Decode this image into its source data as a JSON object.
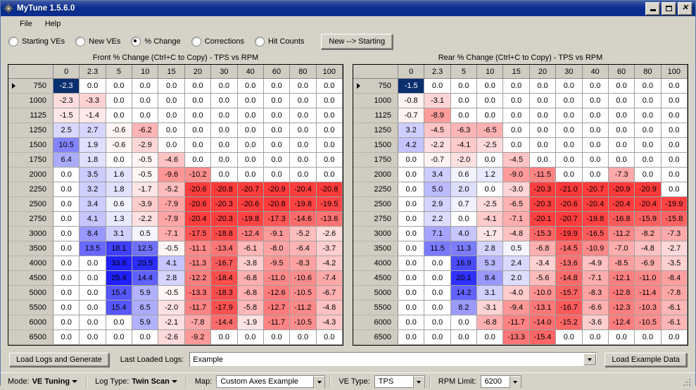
{
  "window": {
    "title": "MyTune 1.5.6.0",
    "icon": "app-gear-icon",
    "minimize": "–",
    "maximize": "□",
    "close": "✕"
  },
  "menu": {
    "items": [
      "File",
      "Help"
    ]
  },
  "view_modes": {
    "options": [
      "Starting VEs",
      "New VEs",
      "% Change",
      "Corrections",
      "Hit Counts"
    ],
    "selected": "% Change",
    "action_button": "New --> Starting"
  },
  "tables": [
    {
      "caption": "Front % Change (Ctrl+C to Copy) - TPS vs RPM",
      "corner": "",
      "columns": [
        "0",
        "2.3",
        "5",
        "10",
        "15",
        "20",
        "30",
        "40",
        "60",
        "80",
        "100"
      ],
      "rows": [
        "750",
        "1000",
        "1125",
        "1250",
        "1500",
        "1750",
        "2000",
        "2250",
        "2500",
        "2750",
        "3000",
        "3500",
        "4000",
        "4500",
        "5000",
        "5500",
        "6000",
        "6500"
      ],
      "selected_cell": [
        0,
        0
      ],
      "values": [
        [
          "-2.3",
          "0.0",
          "0.0",
          "0.0",
          "0.0",
          "0.0",
          "0.0",
          "0.0",
          "0.0",
          "0.0",
          "0.0"
        ],
        [
          "-2.3",
          "-3.3",
          "0.0",
          "0.0",
          "0.0",
          "0.0",
          "0.0",
          "0.0",
          "0.0",
          "0.0",
          "0.0"
        ],
        [
          "-1.5",
          "-1.4",
          "0.0",
          "0.0",
          "0.0",
          "0.0",
          "0.0",
          "0.0",
          "0.0",
          "0.0",
          "0.0"
        ],
        [
          "2.5",
          "2.7",
          "-0.6",
          "-6.2",
          "0.0",
          "0.0",
          "0.0",
          "0.0",
          "0.0",
          "0.0",
          "0.0"
        ],
        [
          "10.5",
          "1.9",
          "-0.6",
          "-2.9",
          "0.0",
          "0.0",
          "0.0",
          "0.0",
          "0.0",
          "0.0",
          "0.0"
        ],
        [
          "6.4",
          "1.8",
          "0.0",
          "-0.5",
          "-4.6",
          "0.0",
          "0.0",
          "0.0",
          "0.0",
          "0.0",
          "0.0"
        ],
        [
          "0.0",
          "3.5",
          "1.6",
          "-0.5",
          "-9.6",
          "-10.2",
          "0.0",
          "0.0",
          "0.0",
          "0.0",
          "0.0"
        ],
        [
          "0.0",
          "3.2",
          "1.8",
          "-1.7",
          "-5.2",
          "-20.6",
          "-20.8",
          "-20.7",
          "-20.9",
          "-20.4",
          "-20.8"
        ],
        [
          "0.0",
          "3.4",
          "0.6",
          "-3.9",
          "-7.9",
          "-20.6",
          "-20.3",
          "-20.6",
          "-20.8",
          "-19.8",
          "-19.5"
        ],
        [
          "0.0",
          "4.1",
          "1.3",
          "-2.2",
          "-7.9",
          "-20.4",
          "-20.3",
          "-19.8",
          "-17.3",
          "-14.6",
          "-13.6"
        ],
        [
          "0.0",
          "8.4",
          "3.1",
          "0.5",
          "-7.1",
          "-17.5",
          "-18.8",
          "-12.4",
          "-9.1",
          "-5.2",
          "-2.6"
        ],
        [
          "0.0",
          "13.5",
          "18.1",
          "12.5",
          "-0.5",
          "-11.1",
          "-13.4",
          "-6.1",
          "-8.0",
          "-6.4",
          "-3.7"
        ],
        [
          "0.0",
          "0.0",
          "33.8",
          "20.5",
          "4.1",
          "-11.3",
          "-16.7",
          "-3.8",
          "-9.5",
          "-8.3",
          "-4.2"
        ],
        [
          "0.0",
          "0.0",
          "25.4",
          "14.4",
          "2.8",
          "-12.2",
          "-18.4",
          "-6.8",
          "-11.0",
          "-10.6",
          "-7.4"
        ],
        [
          "0.0",
          "0.0",
          "15.4",
          "5.9",
          "-0.5",
          "-13.3",
          "-18.3",
          "-6.8",
          "-12.6",
          "-10.5",
          "-6.7"
        ],
        [
          "0.0",
          "0.0",
          "15.4",
          "6.5",
          "-2.0",
          "-11.7",
          "-17.9",
          "-5.8",
          "-12.7",
          "-11.2",
          "-4.8"
        ],
        [
          "0.0",
          "0.0",
          "0.0",
          "5.9",
          "-2.1",
          "-7.8",
          "-14.4",
          "-1.9",
          "-11.7",
          "-10.5",
          "-4.3"
        ],
        [
          "0.0",
          "0.0",
          "0.0",
          "0.0",
          "-2.6",
          "-9.2",
          "0.0",
          "0.0",
          "0.0",
          "0.0",
          "0.0"
        ]
      ]
    },
    {
      "caption": "Rear % Change (Ctrl+C to Copy) - TPS vs RPM",
      "corner": "",
      "columns": [
        "0",
        "2.3",
        "5",
        "10",
        "15",
        "20",
        "30",
        "40",
        "60",
        "80",
        "100"
      ],
      "rows": [
        "750",
        "1000",
        "1125",
        "1250",
        "1500",
        "1750",
        "2000",
        "2250",
        "2500",
        "2750",
        "3000",
        "3500",
        "4000",
        "4500",
        "5000",
        "5500",
        "6000",
        "6500"
      ],
      "selected_cell": [
        0,
        0
      ],
      "values": [
        [
          "-1.5",
          "0.0",
          "0.0",
          "0.0",
          "0.0",
          "0.0",
          "0.0",
          "0.0",
          "0.0",
          "0.0",
          "0.0"
        ],
        [
          "-0.8",
          "-3.1",
          "0.0",
          "0.0",
          "0.0",
          "0.0",
          "0.0",
          "0.0",
          "0.0",
          "0.0",
          "0.0"
        ],
        [
          "-0.7",
          "-8.9",
          "0.0",
          "0.0",
          "0.0",
          "0.0",
          "0.0",
          "0.0",
          "0.0",
          "0.0",
          "0.0"
        ],
        [
          "3.2",
          "-4.5",
          "-6.3",
          "-6.5",
          "0.0",
          "0.0",
          "0.0",
          "0.0",
          "0.0",
          "0.0",
          "0.0"
        ],
        [
          "4.2",
          "-2.2",
          "-4.1",
          "-2.5",
          "0.0",
          "0.0",
          "0.0",
          "0.0",
          "0.0",
          "0.0",
          "0.0"
        ],
        [
          "0.0",
          "-0.7",
          "-2.0",
          "0.0",
          "-4.5",
          "0.0",
          "0.0",
          "0.0",
          "0.0",
          "0.0",
          "0.0"
        ],
        [
          "0.0",
          "3.4",
          "0.6",
          "1.2",
          "-9.0",
          "-11.5",
          "0.0",
          "0.0",
          "-7.3",
          "0.0",
          "0.0"
        ],
        [
          "0.0",
          "5.0",
          "2.0",
          "0.0",
          "-3.0",
          "-20.3",
          "-21.0",
          "-20.7",
          "-20.9",
          "-20.9",
          "0.0"
        ],
        [
          "0.0",
          "2.9",
          "0.7",
          "-2.5",
          "-6.5",
          "-20.3",
          "-20.6",
          "-20.4",
          "-20.4",
          "-20.4",
          "-19.9"
        ],
        [
          "0.0",
          "2.2",
          "0.0",
          "-4.1",
          "-7.1",
          "-20.1",
          "-20.7",
          "-19.8",
          "-16.8",
          "-15.9",
          "-15.8"
        ],
        [
          "0.0",
          "7.1",
          "4.0",
          "-1.7",
          "-4.8",
          "-15.3",
          "-19.9",
          "-16.5",
          "-11.2",
          "-8.2",
          "-7.3"
        ],
        [
          "0.0",
          "11.5",
          "11.3",
          "2.8",
          "0.5",
          "-6.8",
          "-14.5",
          "-10.9",
          "-7.0",
          "-4.8",
          "-2.7"
        ],
        [
          "0.0",
          "0.0",
          "16.9",
          "5.3",
          "2.4",
          "-3.4",
          "-13.6",
          "-4.9",
          "-8.5",
          "-6.9",
          "-3.5"
        ],
        [
          "0.0",
          "0.0",
          "20.1",
          "8.4",
          "2.0",
          "-5.6",
          "-14.8",
          "-7.1",
          "-12.1",
          "-11.0",
          "-8.4"
        ],
        [
          "0.0",
          "0.0",
          "14.2",
          "3.1",
          "-4.0",
          "-10.0",
          "-15.7",
          "-8.3",
          "-12.8",
          "-11.4",
          "-7.8"
        ],
        [
          "0.0",
          "0.0",
          "8.2",
          "-3.1",
          "-9.4",
          "-13.1",
          "-16.7",
          "-6.6",
          "-12.3",
          "-10.3",
          "-6.1"
        ],
        [
          "0.0",
          "0.0",
          "0.0",
          "-6.8",
          "-11.7",
          "-14.0",
          "-15.2",
          "-3.6",
          "-12.4",
          "-10.5",
          "-6.1"
        ],
        [
          "0.0",
          "0.0",
          "0.0",
          "0.0",
          "-13.3",
          "-15.4",
          "0.0",
          "0.0",
          "0.0",
          "0.0",
          "0.0"
        ]
      ]
    }
  ],
  "bottom": {
    "load_logs_button": "Load Logs and Generate",
    "last_loaded_label": "Last Loaded Logs:",
    "last_loaded_value": "Example",
    "load_example_button": "Load Example Data"
  },
  "statusbar": {
    "mode_label": "Mode:",
    "mode_value": "VE Tuning",
    "logtype_label": "Log Type:",
    "logtype_value": "Twin Scan",
    "map_label": "Map:",
    "map_value": "Custom Axes Example",
    "vetype_label": "VE Type:",
    "vetype_value": "TPS",
    "rpmlimit_label": "RPM Limit:",
    "rpmlimit_value": "6200"
  },
  "colors": {
    "titlebar": "#0b2d8e",
    "face": "#d6d2c8",
    "selected_cell_bg": "#0a2f6e",
    "positive": "#0000ff",
    "negative": "#ff0000"
  }
}
